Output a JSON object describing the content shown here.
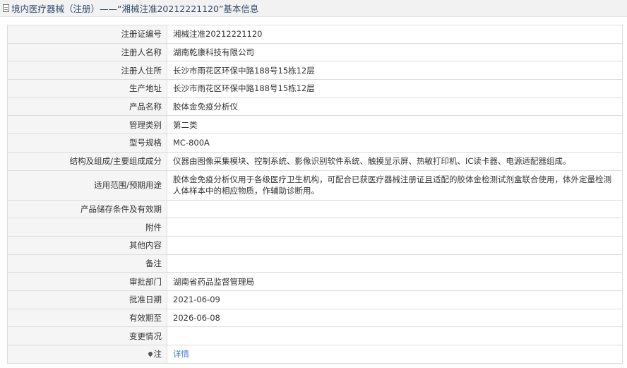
{
  "header": {
    "title": "境内医疗器械（注册）——“湘械注准20212221120”基本信息"
  },
  "rows": [
    {
      "label": "注册证编号",
      "value": "湘械注准20212221120"
    },
    {
      "label": "注册人名称",
      "value": "湖南乾康科技有限公司"
    },
    {
      "label": "注册人住所",
      "value": "长沙市雨花区环保中路188号15栋12层"
    },
    {
      "label": "生产地址",
      "value": "长沙市雨花区环保中路188号15栋12层"
    },
    {
      "label": "产品名称",
      "value": "胶体金免疫分析仪"
    },
    {
      "label": "管理类别",
      "value": "第二类"
    },
    {
      "label": "型号规格",
      "value": "MC-800A"
    },
    {
      "label": "结构及组成/主要组成成分",
      "value": "仪器由图像采集模块、控制系统、影像识别软件系统、触摸显示屏、热敏打印机、IC读卡器、电源适配器组成。"
    },
    {
      "label": "适用范围/预期用途",
      "value": "胶体金免疫分析仪用于各级医疗卫生机构，可配合已获医疗器械注册证且适配的胶体金检测试剂盒联合使用，体外定量检测人体样本中的相应物质，作辅助诊断用。"
    },
    {
      "label": "产品储存条件及有效期",
      "value": ""
    },
    {
      "label": "附件",
      "value": ""
    },
    {
      "label": "其他内容",
      "value": ""
    },
    {
      "label": "备注",
      "value": ""
    },
    {
      "label": "审批部门",
      "value": "湖南省药品监督管理局"
    },
    {
      "label": "批准日期",
      "value": "2021-06-09"
    },
    {
      "label": "有效期至",
      "value": "2026-06-08"
    },
    {
      "label": "变更情况",
      "value": ""
    }
  ],
  "note_row": {
    "label": "注",
    "link_text": "详情"
  }
}
